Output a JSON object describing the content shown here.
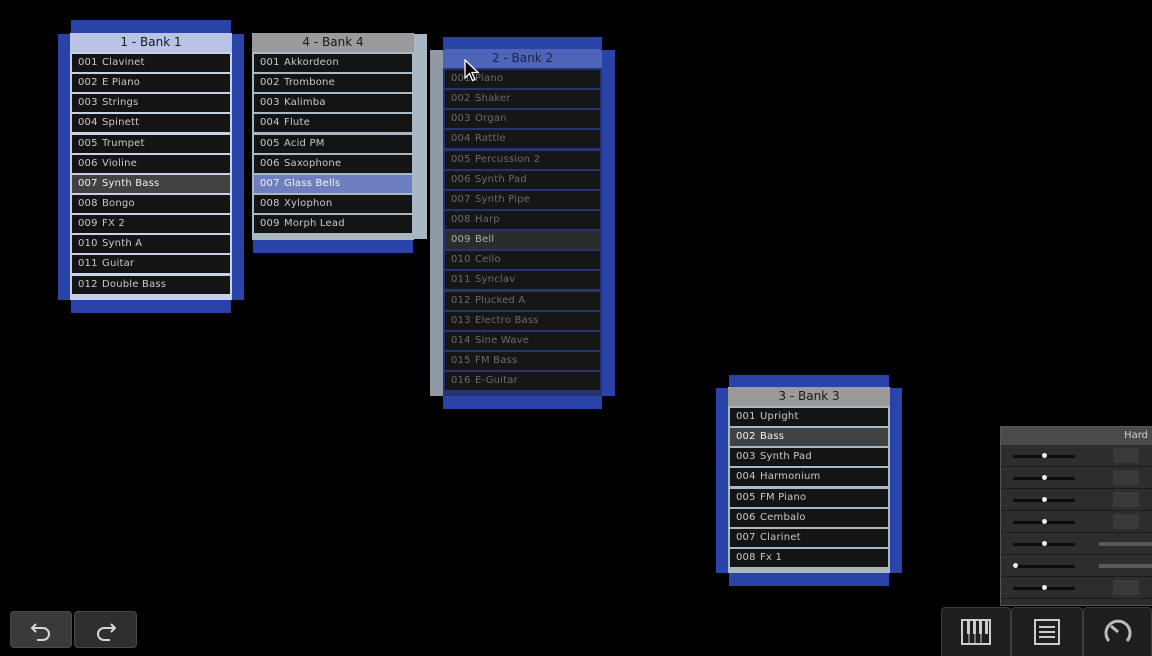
{
  "banks": {
    "bank1": {
      "title": "1 - Bank 1",
      "items": [
        {
          "num": "001",
          "name": "Clavinet"
        },
        {
          "num": "002",
          "name": "E Piano"
        },
        {
          "num": "003",
          "name": "Strings"
        },
        {
          "num": "004",
          "name": "Spinett"
        },
        {
          "num": "005",
          "name": "Trumpet"
        },
        {
          "num": "006",
          "name": "Violine"
        },
        {
          "num": "007",
          "name": "Synth Bass"
        },
        {
          "num": "008",
          "name": "Bongo"
        },
        {
          "num": "009",
          "name": "FX 2"
        },
        {
          "num": "010",
          "name": "Synth A"
        },
        {
          "num": "011",
          "name": "Guitar"
        },
        {
          "num": "012",
          "name": "Double Bass"
        }
      ]
    },
    "bank4": {
      "title": "4 - Bank 4",
      "items": [
        {
          "num": "001",
          "name": "Akkordeon"
        },
        {
          "num": "002",
          "name": "Trombone"
        },
        {
          "num": "003",
          "name": "Kalimba"
        },
        {
          "num": "004",
          "name": "Flute"
        },
        {
          "num": "005",
          "name": "Acid PM"
        },
        {
          "num": "006",
          "name": "Saxophone"
        },
        {
          "num": "007",
          "name": "Glass Bells"
        },
        {
          "num": "008",
          "name": "Xylophon"
        },
        {
          "num": "009",
          "name": "Morph Lead"
        }
      ]
    },
    "bank2": {
      "title": "2 - Bank 2",
      "items": [
        {
          "num": "001",
          "name": "Piano"
        },
        {
          "num": "002",
          "name": "Shaker"
        },
        {
          "num": "003",
          "name": "Organ"
        },
        {
          "num": "004",
          "name": "Rattle"
        },
        {
          "num": "005",
          "name": "Percussion 2"
        },
        {
          "num": "006",
          "name": "Synth Pad"
        },
        {
          "num": "007",
          "name": "Synth Pipe"
        },
        {
          "num": "008",
          "name": "Harp"
        },
        {
          "num": "009",
          "name": "Bell"
        },
        {
          "num": "010",
          "name": "Cello"
        },
        {
          "num": "011",
          "name": "Synclav"
        },
        {
          "num": "012",
          "name": "Plucked A"
        },
        {
          "num": "013",
          "name": "Electro Bass"
        },
        {
          "num": "014",
          "name": "Sine Wave"
        },
        {
          "num": "015",
          "name": "FM Bass"
        },
        {
          "num": "016",
          "name": "E-Guitar"
        }
      ]
    },
    "bank3": {
      "title": "3 - Bank 3",
      "items": [
        {
          "num": "001",
          "name": "Upright"
        },
        {
          "num": "002",
          "name": "Bass"
        },
        {
          "num": "003",
          "name": "Synth Pad"
        },
        {
          "num": "004",
          "name": "Harmonium"
        },
        {
          "num": "005",
          "name": "FM Piano"
        },
        {
          "num": "006",
          "name": "Cembalo"
        },
        {
          "num": "007",
          "name": "Clarinet"
        },
        {
          "num": "008",
          "name": "Fx 1"
        }
      ]
    }
  },
  "hardware_panel": {
    "title": "Hard"
  },
  "colors": {
    "accent_blue": "#2a43a8",
    "selected_blue": "#6e7fc0",
    "background": "#000000"
  }
}
